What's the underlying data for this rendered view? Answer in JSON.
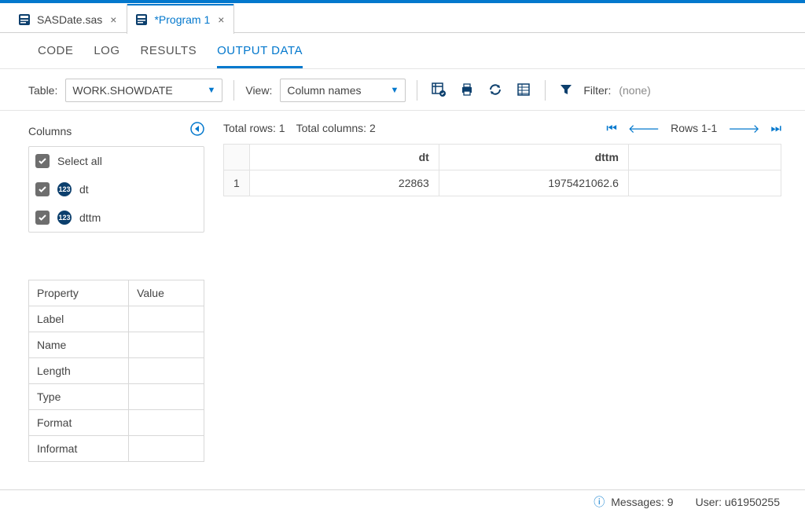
{
  "file_tabs": {
    "tab1": "SASDate.sas",
    "tab2": "*Program 1"
  },
  "inner_tabs": {
    "code": "CODE",
    "log": "LOG",
    "results": "RESULTS",
    "output_data": "OUTPUT DATA"
  },
  "toolbar": {
    "table_label": "Table:",
    "table_value": "WORK.SHOWDATE",
    "view_label": "View:",
    "view_value": "Column names",
    "filter_label": "Filter:",
    "filter_value": "(none)"
  },
  "sidebar": {
    "columns_label": "Columns",
    "select_all": "Select all",
    "cols": {
      "c0": "dt",
      "c1": "dttm"
    },
    "prop_header_key": "Property",
    "prop_header_val": "Value",
    "props": {
      "label": "Label",
      "name": "Name",
      "length": "Length",
      "type": "Type",
      "format": "Format",
      "informat": "Informat"
    }
  },
  "data": {
    "total_rows_label": "Total rows: 1",
    "total_cols_label": "Total columns: 2",
    "rows_range": "Rows 1-1",
    "headers": {
      "h0": "dt",
      "h1": "dttm"
    },
    "row1": {
      "idx": "1",
      "c0": "22863",
      "c1": "1975421062.6"
    }
  },
  "status": {
    "messages_label": "Messages:",
    "messages_count": "9",
    "user_label": "User:",
    "user_value": "u61950255"
  }
}
